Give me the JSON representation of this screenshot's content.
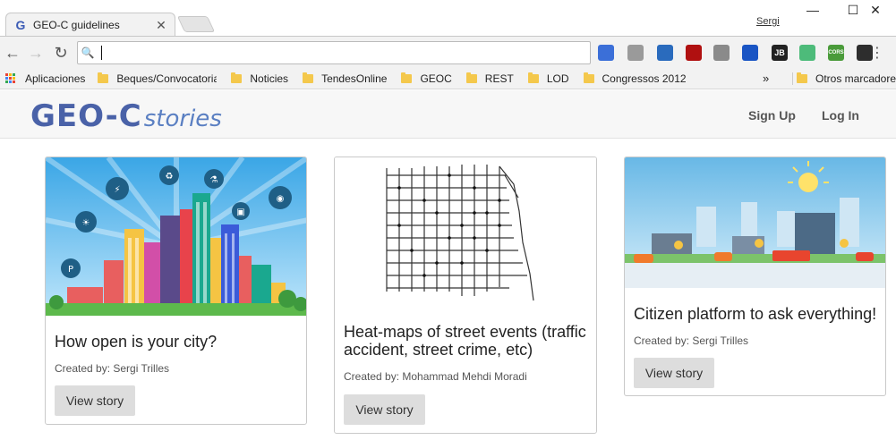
{
  "browser": {
    "tab_title": "GEO-C guidelines",
    "tab_icon": "G",
    "profile_name": "Sergi",
    "address_value": "",
    "extensions": [
      {
        "name": "extension-cap-icon",
        "label": "",
        "color": "#3b6fd8"
      },
      {
        "name": "extension-cube-icon",
        "label": "",
        "color": "#9a9a9a"
      },
      {
        "name": "trello-icon",
        "label": "",
        "color": "#2a6bbd"
      },
      {
        "name": "pdf-icon",
        "label": "",
        "color": "#b01010"
      },
      {
        "name": "camera-icon",
        "label": "",
        "color": "#8a8a8a"
      },
      {
        "name": "drop-icon",
        "label": "",
        "color": "#1a55c4"
      },
      {
        "name": "jb-icon",
        "label": "JB",
        "color": "#222222"
      },
      {
        "name": "target-icon",
        "label": "",
        "color": "#4dbb7a"
      },
      {
        "name": "cors-icon",
        "label": "CORS",
        "color": "#4a9b3a"
      },
      {
        "name": "evernote-icon",
        "label": "",
        "color": "#2d2d2d"
      }
    ]
  },
  "bookmarks": {
    "apps_label": "Aplicaciones",
    "items": [
      "Beques/Convocatoria",
      "Noticies",
      "TendesOnline",
      "GEOC",
      "REST",
      "LOD",
      "Congressos 2012"
    ],
    "overflow": "»",
    "others_label": "Otros marcadores"
  },
  "site": {
    "logo_main": "GEO-C",
    "logo_sub": "stories",
    "nav_signup": "Sign Up",
    "nav_login": "Log In"
  },
  "cards": [
    {
      "title": "How open is your city?",
      "author": "Created by: Sergi Trilles",
      "button": "View story"
    },
    {
      "title": "Heat-maps of street events (traffic accident, street crime, etc)",
      "author": "Created by: Mohammad Mehdi Moradi",
      "button": "View story"
    },
    {
      "title": "Citizen platform to ask everything!",
      "author": "Created by: Sergi Trilles",
      "button": "View story"
    }
  ]
}
